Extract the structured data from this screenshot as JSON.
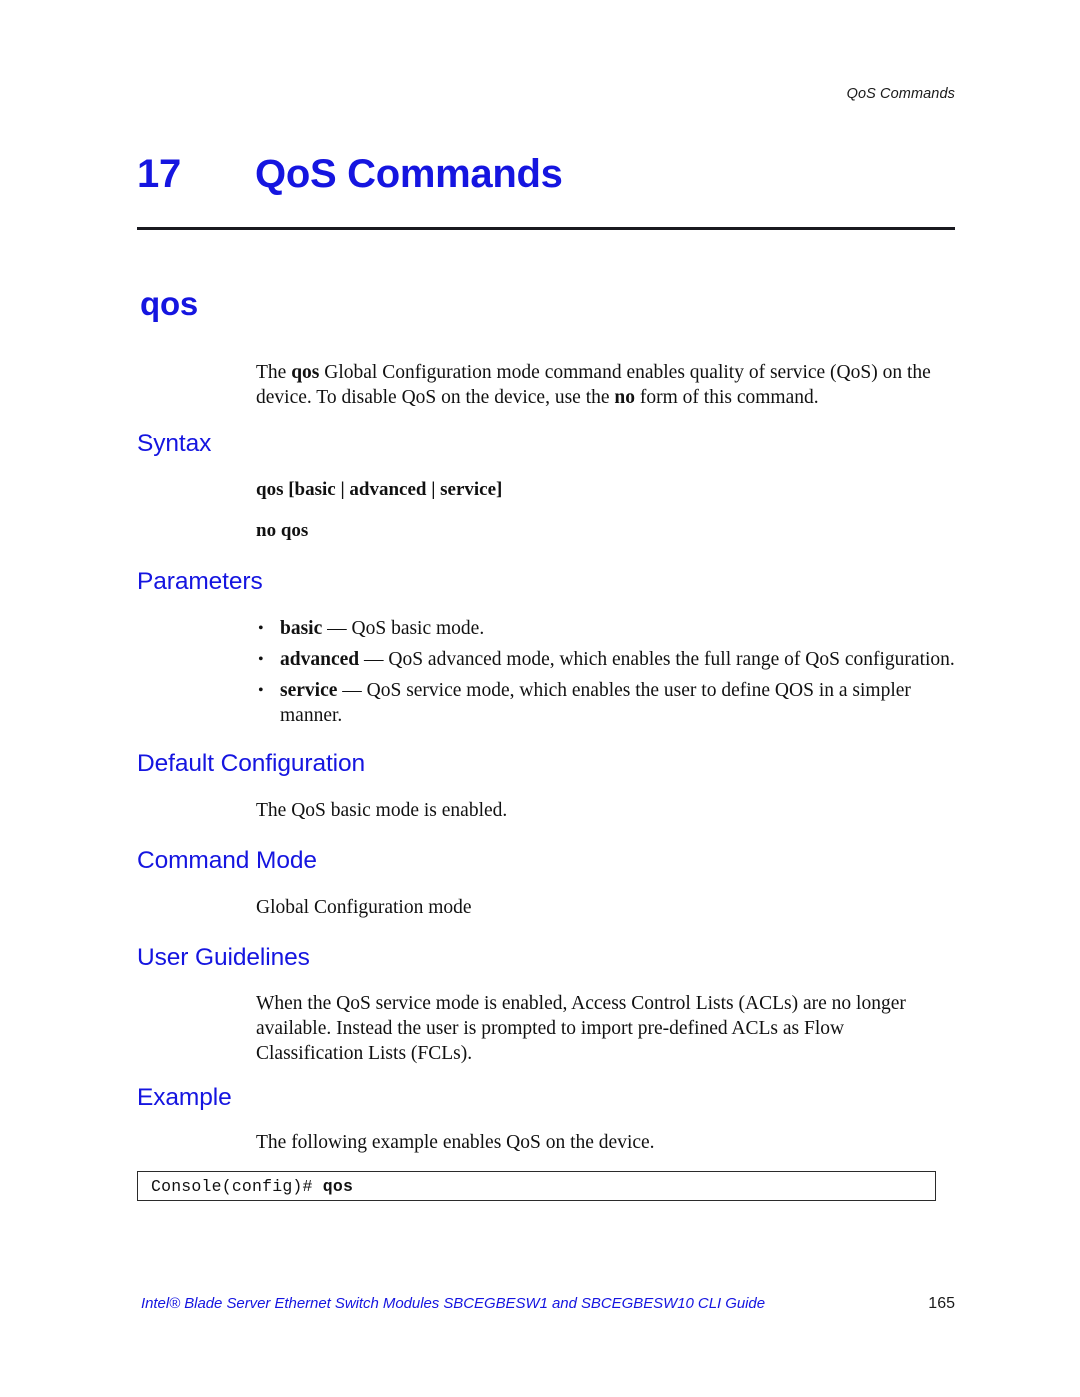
{
  "header": {
    "running_head": "QoS Commands"
  },
  "chapter": {
    "number": "17",
    "title": "QoS Commands"
  },
  "command": {
    "name": "qos",
    "description_part1": "The ",
    "description_bold1": "qos",
    "description_part2": " Global Configuration mode command enables quality of service (QoS) on the device. To disable QoS on the device, use the ",
    "description_bold2": "no",
    "description_part3": " form of this command."
  },
  "sections": {
    "syntax": {
      "heading": "Syntax",
      "lines": [
        "qos [basic | advanced | service]",
        "no qos"
      ]
    },
    "parameters": {
      "heading": "Parameters",
      "items": [
        {
          "term": "basic",
          "dash": " — ",
          "desc": "QoS basic mode."
        },
        {
          "term": "advanced",
          "dash": " — ",
          "desc": "QoS advanced mode, which enables the full range of QoS configuration."
        },
        {
          "term": "service",
          "dash": " — ",
          "desc": "QoS service mode, which enables the user to define QOS in a simpler manner."
        }
      ]
    },
    "default_configuration": {
      "heading": "Default Configuration",
      "text": "The QoS basic mode is enabled."
    },
    "command_mode": {
      "heading": "Command Mode",
      "text": "Global Configuration mode"
    },
    "user_guidelines": {
      "heading": "User Guidelines",
      "text": "When the QoS service mode is enabled, Access Control Lists (ACLs) are no longer available. Instead the user is prompted to import pre-defined ACLs as Flow Classification Lists (FCLs)."
    },
    "example": {
      "heading": "Example",
      "text": "The following example enables QoS on the device.",
      "console_prompt": "Console(config)# ",
      "console_command": "qos"
    }
  },
  "footer": {
    "guide_title": "Intel® Blade Server Ethernet Switch Modules SBCEGBESW1 and SBCEGBESW10 CLI Guide",
    "page_number": "165"
  },
  "colors": {
    "heading_blue": "#1515e0",
    "body_black": "#111111",
    "rule_black": "#19191f"
  }
}
